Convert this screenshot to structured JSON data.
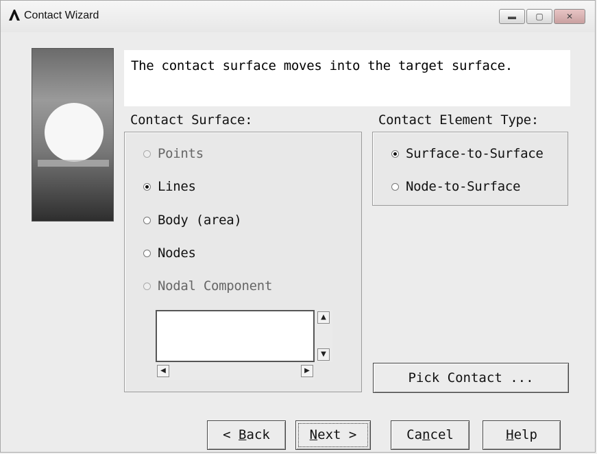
{
  "window": {
    "title": "Contact Wizard"
  },
  "message": "The contact surface moves into the target surface.",
  "contact_surface": {
    "label": "Contact Surface:",
    "options": [
      "Points",
      "Lines",
      "Body (area)",
      "Nodes",
      "Nodal Component"
    ],
    "selected": "Lines"
  },
  "element_type": {
    "label": "Contact Element Type:",
    "options": [
      "Surface-to-Surface",
      "Node-to-Surface"
    ],
    "selected": "Surface-to-Surface"
  },
  "buttons": {
    "pick_contact": "Pick Contact ...",
    "back_prefix": "< ",
    "back_mnemonic": "B",
    "back_rest": "ack",
    "next_mnemonic": "N",
    "next_rest": "ext >",
    "cancel_pre": "Ca",
    "cancel_mnemonic": "n",
    "cancel_rest": "cel",
    "help_mnemonic": "H",
    "help_rest": "elp"
  },
  "icons": {
    "app": "ansys-logo-icon",
    "minimize": "minimize-icon",
    "maximize": "maximize-icon",
    "close": "close-icon"
  }
}
